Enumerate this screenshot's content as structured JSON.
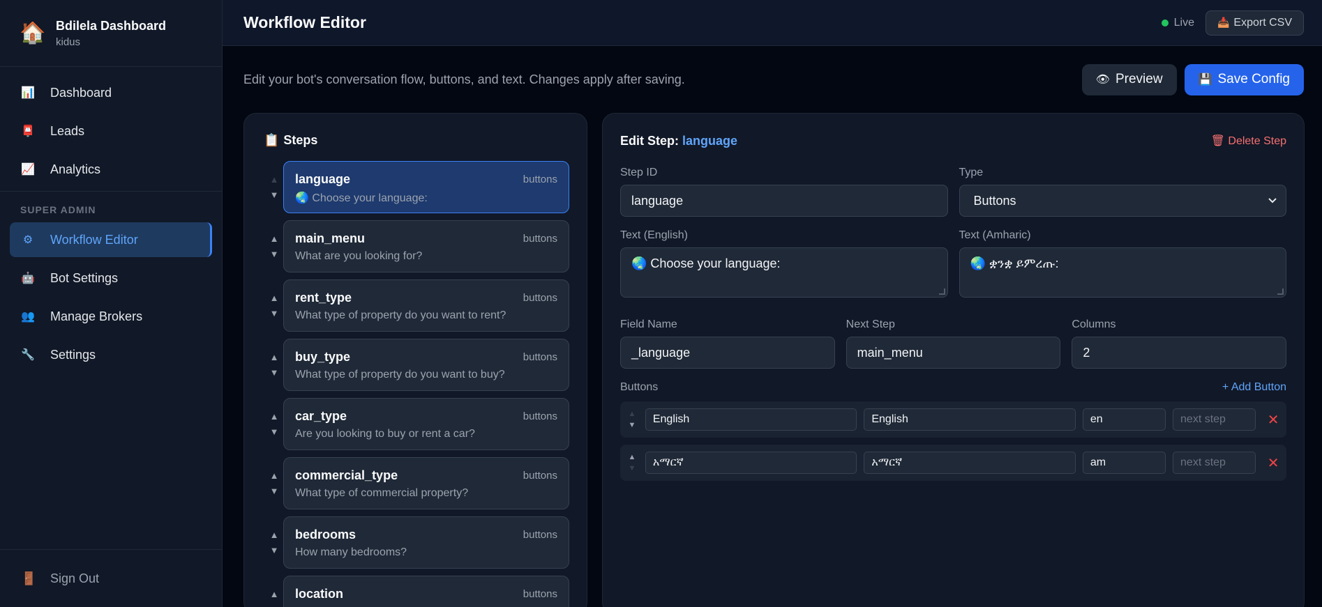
{
  "app": {
    "brand_icon": "🏠",
    "title": "Bdilela Dashboard",
    "user": "kidus"
  },
  "sidebar": {
    "items": [
      {
        "icon": "📊",
        "label": "Dashboard"
      },
      {
        "icon": "📮",
        "label": "Leads"
      },
      {
        "icon": "📈",
        "label": "Analytics"
      }
    ],
    "section_label": "SUPER ADMIN",
    "admin_items": [
      {
        "icon": "⚙",
        "label": "Workflow Editor",
        "active": true
      },
      {
        "icon": "🤖",
        "label": "Bot Settings"
      },
      {
        "icon": "👥",
        "label": "Manage Brokers"
      },
      {
        "icon": "🔧",
        "label": "Settings"
      }
    ],
    "signout": {
      "icon": "🚪",
      "label": "Sign Out"
    }
  },
  "header": {
    "title": "Workflow Editor",
    "live_label": "Live",
    "export": {
      "icon": "📥",
      "label": "Export CSV"
    }
  },
  "toolbar": {
    "subtitle": "Edit your bot's conversation flow, buttons, and text. Changes apply after saving.",
    "preview": {
      "icon": "👁",
      "label": "Preview"
    },
    "save": {
      "icon": "💾",
      "label": "Save Config"
    }
  },
  "steps_panel": {
    "icon": "📋",
    "title": "Steps",
    "steps": [
      {
        "name": "language",
        "type": "buttons",
        "text": "🌏 Choose your language:"
      },
      {
        "name": "main_menu",
        "type": "buttons",
        "text": "What are you looking for?"
      },
      {
        "name": "rent_type",
        "type": "buttons",
        "text": "What type of property do you want to rent?"
      },
      {
        "name": "buy_type",
        "type": "buttons",
        "text": "What type of property do you want to buy?"
      },
      {
        "name": "car_type",
        "type": "buttons",
        "text": "Are you looking to buy or rent a car?"
      },
      {
        "name": "commercial_type",
        "type": "buttons",
        "text": "What type of commercial property?"
      },
      {
        "name": "bedrooms",
        "type": "buttons",
        "text": "How many bedrooms?"
      },
      {
        "name": "location",
        "type": "buttons",
        "text": ""
      }
    ]
  },
  "editor": {
    "title_prefix": "Edit Step:",
    "title_step": "language",
    "delete_icon": "🗑",
    "delete_label": "Delete Step",
    "step_id": {
      "label": "Step ID",
      "value": "language"
    },
    "type": {
      "label": "Type",
      "value": "Buttons"
    },
    "text_en": {
      "label": "Text (English)",
      "value": "🌏 Choose your language:"
    },
    "text_am": {
      "label": "Text (Amharic)",
      "value": "🌏 ቋንቋ ይምረጡ:"
    },
    "field_name": {
      "label": "Field Name",
      "value": "_language"
    },
    "next_step": {
      "label": "Next Step",
      "value": "main_menu"
    },
    "columns": {
      "label": "Columns",
      "value": "2"
    },
    "buttons_label": "Buttons",
    "add_button_label": "+ Add Button",
    "next_step_placeholder": "next step",
    "buttons": [
      {
        "text_en": "English",
        "text_am": "English",
        "value": "en"
      },
      {
        "text_en": "አማርኛ",
        "text_am": "አማርኛ",
        "value": "am"
      }
    ]
  }
}
